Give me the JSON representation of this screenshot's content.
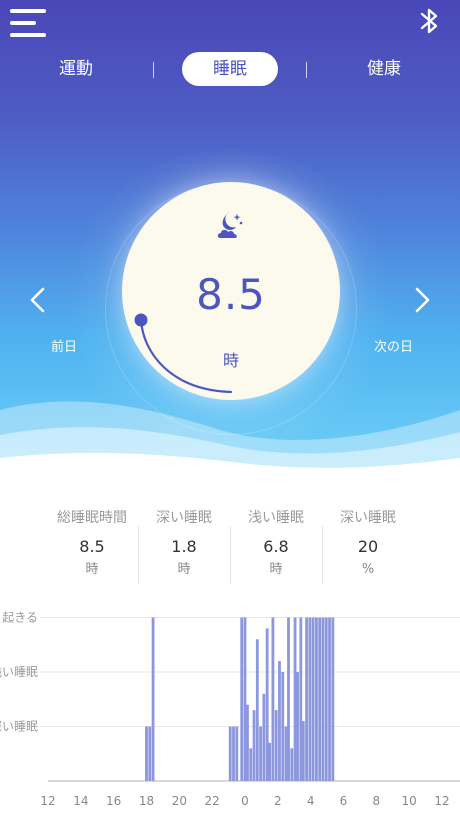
{
  "tabs": [
    {
      "label": "運動",
      "active": false
    },
    {
      "label": "睡眠",
      "active": true
    },
    {
      "label": "健康",
      "active": false
    }
  ],
  "nav": {
    "prev_label": "前日",
    "next_label": "次の日"
  },
  "summary": {
    "value": "8.5",
    "unit": "時",
    "icon": "moon-stars-cloud-icon"
  },
  "stats": [
    {
      "label": "総睡眠時間",
      "value": "8.5",
      "unit": "時"
    },
    {
      "label": "深い睡眠",
      "value": "1.8",
      "unit": "時"
    },
    {
      "label": "浅い睡眠",
      "value": "6.8",
      "unit": "時"
    },
    {
      "label": "深い睡眠",
      "value": "20",
      "unit": "%"
    }
  ],
  "icons": {
    "menu": "menu-icon",
    "bluetooth": "bluetooth-icon",
    "prev": "chevron-left-icon",
    "next": "chevron-right-icon"
  },
  "colors": {
    "accent": "#4d56bf",
    "bar": "#8c97dd",
    "header_top": "#4a47b8",
    "header_bottom": "#6fd0f7"
  },
  "chart_data": {
    "type": "bar",
    "y_categories": [
      "深い睡眠",
      "浅い睡眠",
      "起きる"
    ],
    "y_tick_labels": [
      "起きる",
      "浅い睡眠",
      "深い睡眠"
    ],
    "x_tick_labels": [
      "12",
      "14",
      "16",
      "18",
      "20",
      "22",
      "0",
      "2",
      "4",
      "6",
      "8",
      "10",
      "12"
    ],
    "x_range_hours": [
      0,
      24
    ],
    "grid": true,
    "bars": [
      {
        "x": 6.0,
        "level": 1
      },
      {
        "x": 6.2,
        "level": 1
      },
      {
        "x": 6.4,
        "level": 3
      },
      {
        "x": 11.1,
        "level": 1
      },
      {
        "x": 11.3,
        "level": 1
      },
      {
        "x": 11.5,
        "level": 1
      },
      {
        "x": 11.8,
        "level": 3
      },
      {
        "x": 12.0,
        "level": 3
      },
      {
        "x": 12.15,
        "level": 1.4
      },
      {
        "x": 12.35,
        "level": 0.6
      },
      {
        "x": 12.55,
        "level": 1.3
      },
      {
        "x": 12.75,
        "level": 2.6
      },
      {
        "x": 12.95,
        "level": 1.0
      },
      {
        "x": 13.15,
        "level": 1.6
      },
      {
        "x": 13.35,
        "level": 2.8
      },
      {
        "x": 13.5,
        "level": 0.7
      },
      {
        "x": 13.7,
        "level": 3
      },
      {
        "x": 13.9,
        "level": 1.3
      },
      {
        "x": 14.1,
        "level": 2.2
      },
      {
        "x": 14.3,
        "level": 2.0
      },
      {
        "x": 14.5,
        "level": 1.0
      },
      {
        "x": 14.65,
        "level": 3
      },
      {
        "x": 14.85,
        "level": 0.6
      },
      {
        "x": 15.05,
        "level": 3
      },
      {
        "x": 15.2,
        "level": 2.0
      },
      {
        "x": 15.4,
        "level": 3
      },
      {
        "x": 15.55,
        "level": 1.1
      },
      {
        "x": 15.75,
        "level": 3
      },
      {
        "x": 15.95,
        "level": 3
      },
      {
        "x": 16.15,
        "level": 3
      },
      {
        "x": 16.35,
        "level": 3
      },
      {
        "x": 16.55,
        "level": 3
      },
      {
        "x": 16.75,
        "level": 3
      },
      {
        "x": 16.95,
        "level": 3
      },
      {
        "x": 17.15,
        "level": 3
      },
      {
        "x": 17.35,
        "level": 3
      }
    ]
  }
}
